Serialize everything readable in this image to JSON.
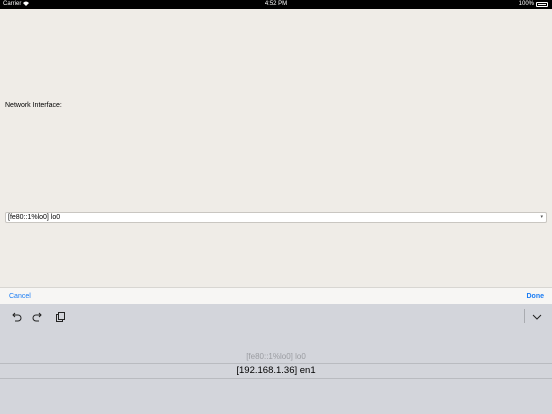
{
  "status_bar": {
    "carrier": "Carrier",
    "time": "4:52 PM",
    "battery": "100%"
  },
  "form": {
    "interface_label": "Network Interface:",
    "selected_value": "[fe80::1%lo0] lo0"
  },
  "picker_toolbar": {
    "cancel_label": "Cancel",
    "done_label": "Done"
  },
  "shortcuts": {
    "icons": [
      "undo-icon",
      "redo-icon",
      "paste-icon",
      "chevron-down-icon"
    ]
  },
  "picker": {
    "options": [
      "[fe80::1%lo0] lo0",
      "[192.168.1.36] en1"
    ],
    "highlighted": "[192.168.1.36] en1"
  }
}
